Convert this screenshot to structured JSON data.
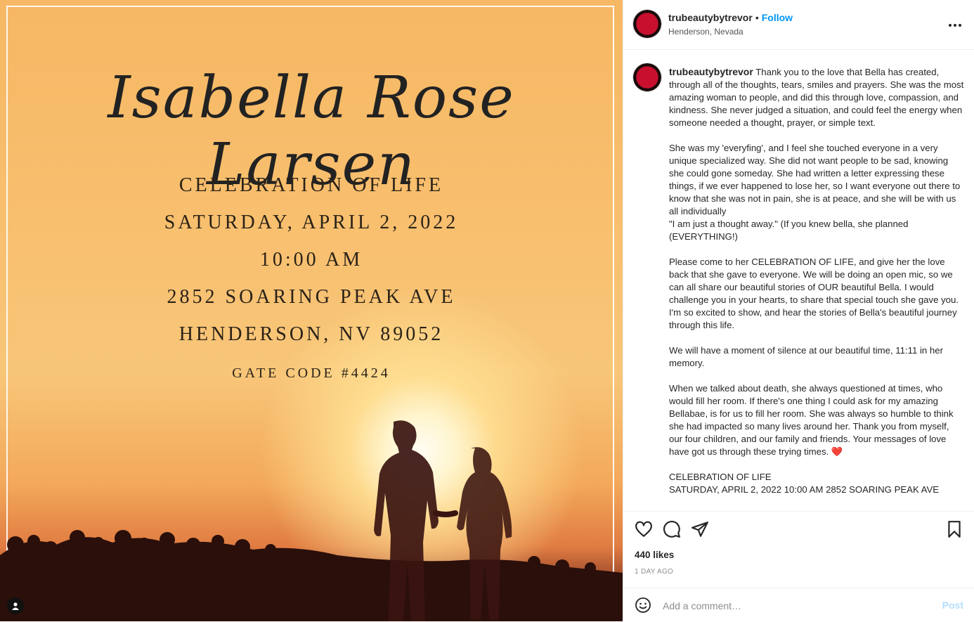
{
  "post_image": {
    "name_script": "Isabella Rose Larsen",
    "lines": [
      "CELEBRATION OF LIFE",
      "SATURDAY, APRIL 2, 2022",
      "10:00 AM",
      "2852 SOARING PEAK AVE",
      "HENDERSON, NV 89052",
      "GATE CODE #4424"
    ],
    "tag_icon": "user-icon"
  },
  "header": {
    "username": "trubeautybytrevor",
    "separator": "•",
    "follow_label": "Follow",
    "location": "Henderson, Nevada",
    "more_icon": "more-options-icon"
  },
  "caption": {
    "username": "trubeautybytrevor",
    "text": " Thank you to the love that Bella has created, through all of the thoughts, tears, smiles and prayers. She was the most amazing woman to people, and did this through love, compassion, and kindness. She never judged a situation, and could feel the energy when someone needed a thought, prayer, or simple text.\n\nShe was my 'everyfing', and I feel she touched everyone in a very unique specialized way. She did not want people to be sad, knowing she could gone someday. She had written a letter expressing these things, if we ever happened to lose her, so I want everyone out there to know that she was not in pain, she is at peace, and she will be with us all individually\n\"I am just a thought away.\" (If you knew bella, she planned (EVERYTHING!)\n\nPlease come to her CELEBRATION OF LIFE, and give her the love back that she gave to everyone. We will be doing an open mic, so we can all share our beautiful stories of OUR beautiful Bella. I would challenge you in your hearts, to share that special touch she gave you. I'm so excited to show, and hear the stories of Bella's beautiful journey through this life.\n\nWe will have a moment of silence at our beautiful time, 11:11 in her memory.\n\nWhen we talked about death, she always questioned at times, who would fill her room. If there's one thing I could ask for my amazing Bellabae, is for us to fill her room. She was always so humble to think she had impacted so many lives around her. Thank you from myself, our four children, and our family and friends. Your messages of love have got us through these trying times. ",
    "heart_emoji": "❤️",
    "tail": "\n\nCELEBRATION OF LIFE\nSATURDAY, APRIL 2, 2022 10:00 AM 2852 SOARING PEAK AVE"
  },
  "actions": {
    "icons": [
      "heart-icon",
      "comment-icon",
      "share-icon",
      "bookmark-icon"
    ]
  },
  "likes": "440 likes",
  "timestamp": "1 DAY AGO",
  "comment_bar": {
    "placeholder": "Add a comment…",
    "post_label": "Post"
  },
  "colors": {
    "accent": "#0095f6",
    "post_disabled": "#b2dffc",
    "text": "#262626",
    "muted": "#8e8e8e",
    "border": "#efefef"
  }
}
